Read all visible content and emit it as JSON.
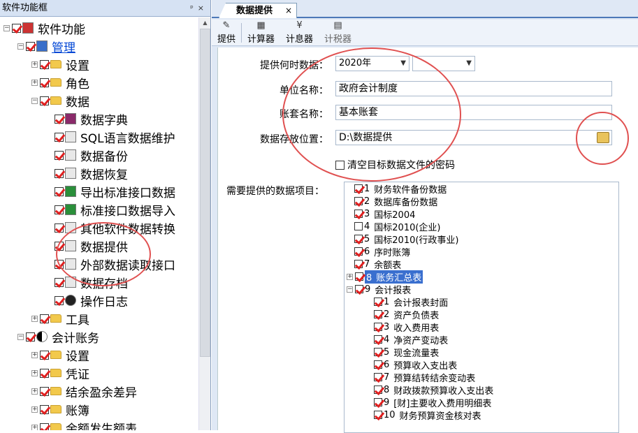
{
  "left_panel": {
    "title": "软件功能框",
    "pin": "ᵖ",
    "close": "×",
    "tree": [
      {
        "label": "软件功能",
        "checked": true,
        "icon": "app-icon"
      },
      {
        "label": "管理",
        "checked": true,
        "icon": "computer-icon"
      },
      {
        "label": "设置",
        "checked": true,
        "icon": "folder-icon"
      },
      {
        "label": "角色",
        "checked": true,
        "icon": "folder-icon"
      },
      {
        "label": "数据",
        "checked": true,
        "icon": "folder-icon"
      },
      {
        "label": "数据字典",
        "checked": true,
        "icon": "book-icon"
      },
      {
        "label": "SQL语言数据维护",
        "checked": true,
        "icon": "sql-icon"
      },
      {
        "label": "数据备份",
        "checked": true,
        "icon": "backup-icon"
      },
      {
        "label": "数据恢复",
        "checked": true,
        "icon": "restore-icon"
      },
      {
        "label": "导出标准接口数据",
        "checked": true,
        "icon": "export-icon"
      },
      {
        "label": "标准接口数据导入",
        "checked": true,
        "icon": "import-icon"
      },
      {
        "label": "其他软件数据转换",
        "checked": true,
        "icon": "convert-icon"
      },
      {
        "label": "数据提供",
        "checked": true,
        "icon": "provide-icon"
      },
      {
        "label": "外部数据读取接口",
        "checked": true,
        "icon": "external-icon"
      },
      {
        "label": "数据存档",
        "checked": true,
        "icon": "archive-icon"
      },
      {
        "label": "操作日志",
        "checked": true,
        "icon": "eye-icon"
      },
      {
        "label": "工具",
        "checked": true,
        "icon": "folder-icon"
      },
      {
        "label": "会计账务",
        "checked": true,
        "icon": "yinyang-icon"
      },
      {
        "label": "设置",
        "checked": true,
        "icon": "folder-icon"
      },
      {
        "label": "凭证",
        "checked": true,
        "icon": "folder-icon"
      },
      {
        "label": "结余盈余差异",
        "checked": true,
        "icon": "folder-icon"
      },
      {
        "label": "账簿",
        "checked": true,
        "icon": "folder-icon"
      },
      {
        "label": "余额发生额表",
        "checked": true,
        "icon": "folder-icon"
      }
    ]
  },
  "tab": {
    "label": "数据提供",
    "close": "×"
  },
  "toolbar": {
    "provide": {
      "label": "提供",
      "icon": "✎"
    },
    "calculator": {
      "label": "计算器",
      "icon": "▦"
    },
    "interest": {
      "label": "计息器",
      "icon": "¥"
    },
    "tax": {
      "label": "计税器",
      "icon": "▤"
    }
  },
  "form": {
    "when_label": "提供何时数据：",
    "year_value": "2020年",
    "period_value": "",
    "unit_label": "单位名称：",
    "unit_value": "政府会计制度",
    "book_label": "账套名称：",
    "book_value": "基本账套",
    "path_label": "数据存放位置：",
    "path_value": "D:\\数据提供",
    "clear_pwd_label": "清空目标数据文件的密码",
    "items_label": "需要提供的数据项目："
  },
  "items": [
    {
      "num": "1",
      "label": "财务软件备份数据",
      "checked": true
    },
    {
      "num": "2",
      "label": "数据库备份数据",
      "checked": true
    },
    {
      "num": "3",
      "label": "国标2004",
      "checked": true
    },
    {
      "num": "4",
      "label": "国标2010(企业)",
      "checked": false
    },
    {
      "num": "5",
      "label": "国标2010(行政事业)",
      "checked": true
    },
    {
      "num": "6",
      "label": "序时账簿",
      "checked": true
    },
    {
      "num": "7",
      "label": "余额表",
      "checked": true
    },
    {
      "num": "8",
      "label": "账务汇总表",
      "checked": true
    },
    {
      "num": "9",
      "label": "会计报表",
      "checked": true
    },
    {
      "num": "1",
      "label": "会计报表封面",
      "checked": true
    },
    {
      "num": "2",
      "label": "资产负债表",
      "checked": true
    },
    {
      "num": "3",
      "label": "收入费用表",
      "checked": true
    },
    {
      "num": "4",
      "label": "净资产变动表",
      "checked": true
    },
    {
      "num": "5",
      "label": "现金流量表",
      "checked": true
    },
    {
      "num": "6",
      "label": "预算收入支出表",
      "checked": true
    },
    {
      "num": "7",
      "label": "预算结转结余变动表",
      "checked": true
    },
    {
      "num": "8",
      "label": "财政拨款预算收入支出表",
      "checked": true
    },
    {
      "num": "9",
      "label": "[财]主要收入费用明细表",
      "checked": true
    },
    {
      "num": "10",
      "label": "财务预算资金核对表",
      "checked": true
    }
  ],
  "colors": {
    "accent": "#4c78b8",
    "check": "#e02020",
    "annotation": "#e05050",
    "selection": "#3a6fcf"
  }
}
